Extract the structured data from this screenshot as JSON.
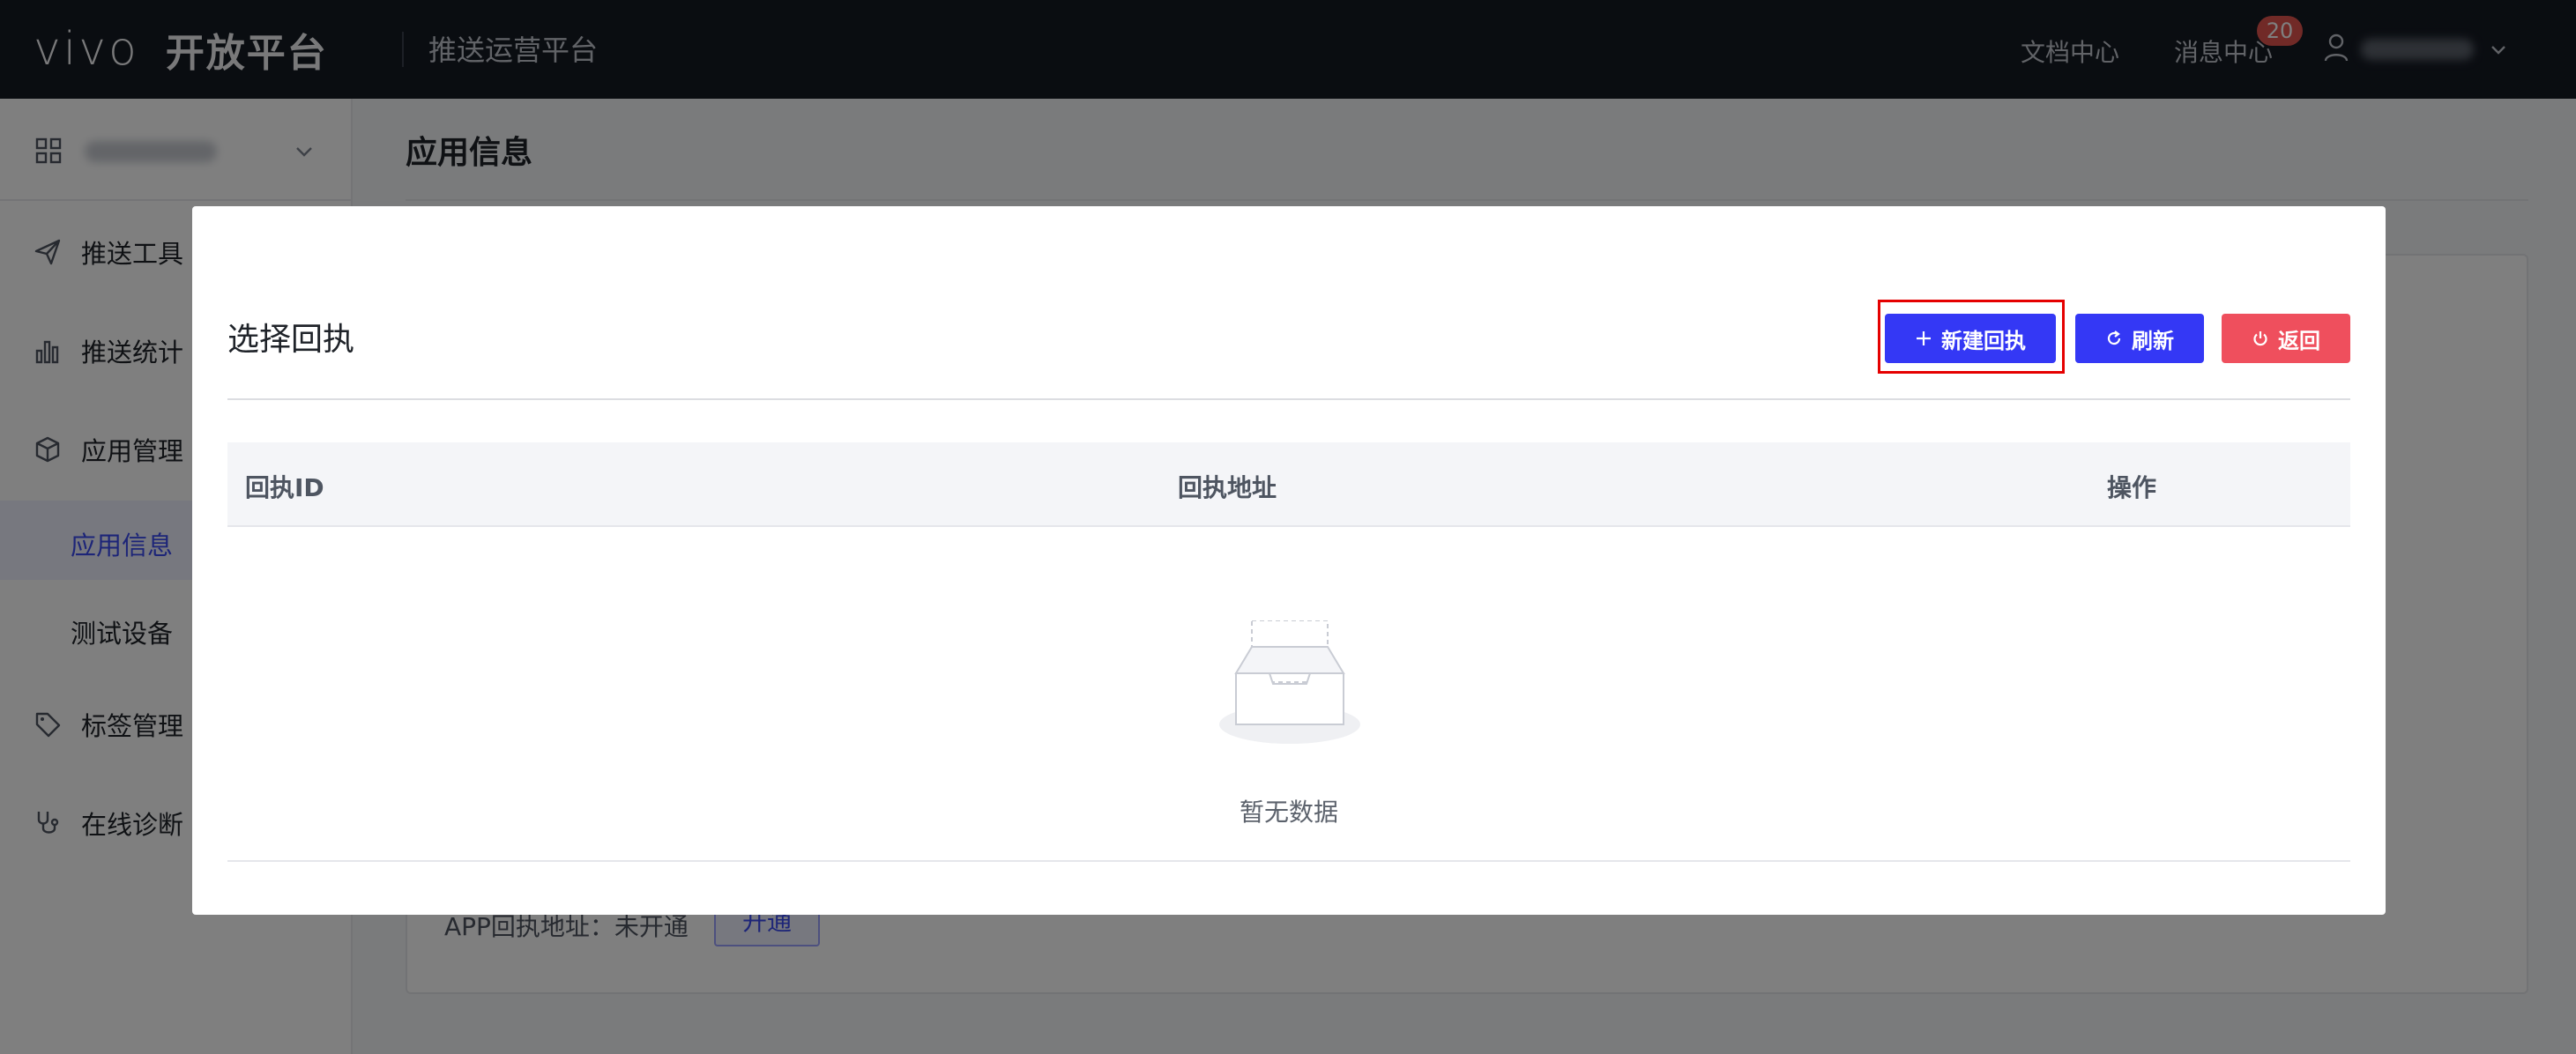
{
  "header": {
    "logo_text": "vivo",
    "platform_title": "开放平台",
    "subtitle": "推送运营平台",
    "docs_link": "文档中心",
    "messages_link": "消息中心",
    "messages_badge": "20"
  },
  "sidebar": {
    "items": [
      {
        "label": "推送工具",
        "icon": "paper-plane-icon"
      },
      {
        "label": "推送统计",
        "icon": "bar-chart-icon"
      },
      {
        "label": "应用管理",
        "icon": "cube-icon"
      },
      {
        "label": "应用信息",
        "active": true
      },
      {
        "label": "测试设备"
      },
      {
        "label": "标签管理",
        "icon": "tag-icon"
      },
      {
        "label": "在线诊断",
        "icon": "stethoscope-icon"
      }
    ]
  },
  "main": {
    "title": "应用信息",
    "app_callback_field": "APP回执地址：未开通",
    "enable_button": "开通"
  },
  "modal": {
    "title": "选择回执",
    "new_button": "新建回执",
    "refresh_button": "刷新",
    "back_button": "返回",
    "columns": [
      "回执ID",
      "回执地址",
      "操作"
    ],
    "empty_text": "暂无数据"
  },
  "colors": {
    "primary": "#3438f5",
    "danger": "#ef4f5d",
    "topbar": "#151a23",
    "highlight": "#e50000"
  }
}
